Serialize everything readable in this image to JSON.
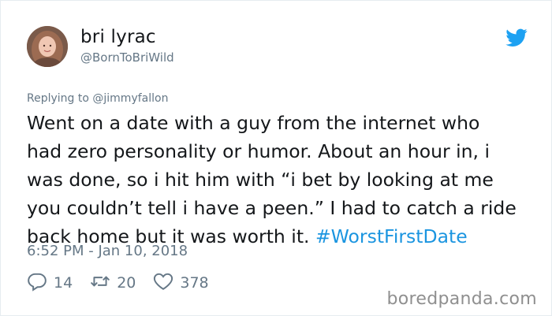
{
  "author": {
    "display_name": "bri lyrac",
    "handle": "@BornToBriWild"
  },
  "reply": {
    "prefix": "Replying to ",
    "mention": "@jimmyfallon"
  },
  "tweet": {
    "lines": [
      "Went on a date with a guy from the internet who",
      "had zero personality or humor. About an hour in, i",
      "was done, so i hit him with “i bet by looking at me",
      "you couldn’t tell i have a peen.” I had to catch a ride",
      "back home but it was worth it. "
    ],
    "hashtag": "#WorstFirstDate",
    "timestamp": "6:52 PM - Jan 10, 2018"
  },
  "stats": {
    "replies": "14",
    "retweets": "20",
    "likes": "378"
  },
  "watermark": "boredpanda.com",
  "colors": {
    "text": "#14171a",
    "muted": "#657786",
    "link": "#1b95e0",
    "twitter_blue": "#1da1f2"
  },
  "icons": [
    "twitter-bird-icon",
    "reply-icon",
    "retweet-icon",
    "like-icon"
  ]
}
